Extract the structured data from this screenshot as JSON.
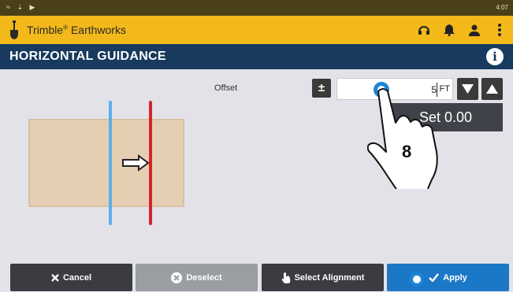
{
  "status_bar": {
    "indicators": "≈ ⇣ ▶",
    "time": "4:07"
  },
  "app_bar": {
    "brand": "Trimble",
    "brand_mark": "®",
    "product": "Earthworks",
    "icons": [
      "headset-icon",
      "bell-icon",
      "user-icon",
      "more-vertical-icon"
    ]
  },
  "header": {
    "title": "HORIZONTAL GUIDANCE",
    "info_icon": "i"
  },
  "offset": {
    "label": "Offset",
    "plus_minus": "±",
    "value": "5",
    "unit": "FT",
    "set_tooltip": "Set 0.00"
  },
  "gesture": {
    "step_number": "8"
  },
  "footer": {
    "cancel": "Cancel",
    "deselect": "Deselect",
    "select_alignment": "Select Alignment",
    "apply": "Apply"
  },
  "colors": {
    "status_bar": "#4a4018",
    "app_bar": "#f3b81a",
    "header": "#173a5e",
    "apply": "#1b78c6",
    "alignment_line": "#5ab0ea",
    "offset_line": "#d8232a",
    "plan_area": "#e5cfb3"
  }
}
